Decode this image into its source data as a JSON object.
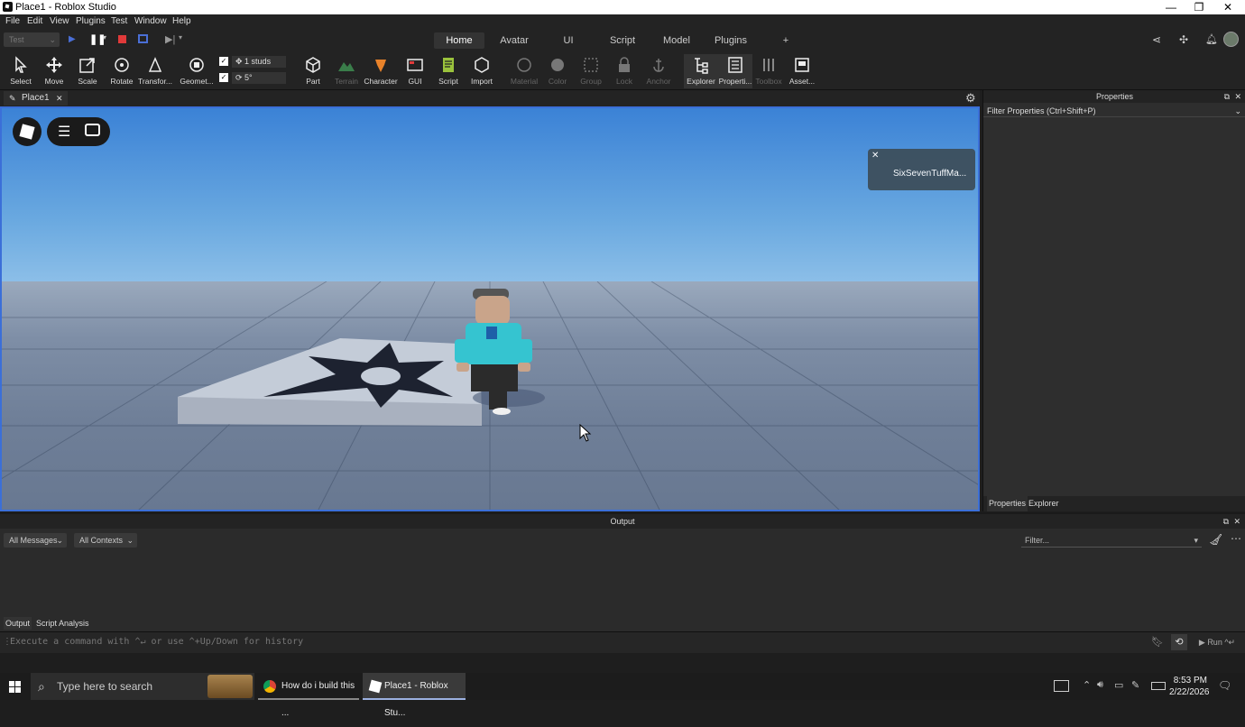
{
  "window": {
    "title": "Place1 - Roblox Studio",
    "minimize": "—",
    "restore": "❐",
    "close": "✕"
  },
  "menu": [
    "File",
    "Edit",
    "View",
    "Plugins",
    "Test",
    "Window",
    "Help"
  ],
  "test_dropdown": "Test",
  "tabs": [
    "Home",
    "Avatar",
    "UI",
    "Script",
    "Model",
    "Plugins",
    "+"
  ],
  "ribbon": {
    "select": "Select",
    "move": "Move",
    "scale": "Scale",
    "rotate": "Rotate",
    "transform": "Transfor...",
    "geometry": "Geomet...",
    "move_snap": "1 studs",
    "rotate_snap": "5°",
    "part": "Part",
    "terrain": "Terrain",
    "character": "Character",
    "gui": "GUI",
    "script": "Script",
    "import": "Import",
    "material": "Material",
    "color": "Color",
    "group": "Group",
    "lock": "Lock",
    "anchor": "Anchor",
    "explorer": "Explorer",
    "properties": "Properti...",
    "toolbox": "Toolbox",
    "assets": "Asset..."
  },
  "viewport": {
    "tab": "Place1",
    "toast_name": "SixSevenTuffMa..."
  },
  "properties": {
    "title": "Properties",
    "filter": "Filter Properties (Ctrl+Shift+P)",
    "bottom_tabs": [
      "Properties",
      "Explorer"
    ]
  },
  "output": {
    "title": "Output",
    "messages_filter": "All Messages",
    "contexts_filter": "All Contexts",
    "filter_placeholder": "Filter...",
    "bottom_tabs": [
      "Output",
      "Script Analysis"
    ],
    "command_placeholder": "Execute a command with ^↵ or use ^+Up/Down for history",
    "run": "Run ^↵"
  },
  "taskbar": {
    "search": "Type here to search",
    "apps": [
      "How do i build this ...",
      "Place1 - Roblox Stu..."
    ],
    "time": "8:53 PM",
    "date": "2/22/2026"
  },
  "colors": {
    "accent": "#3b6fd8",
    "dark": "#232323",
    "panel": "#2e2e2e"
  }
}
